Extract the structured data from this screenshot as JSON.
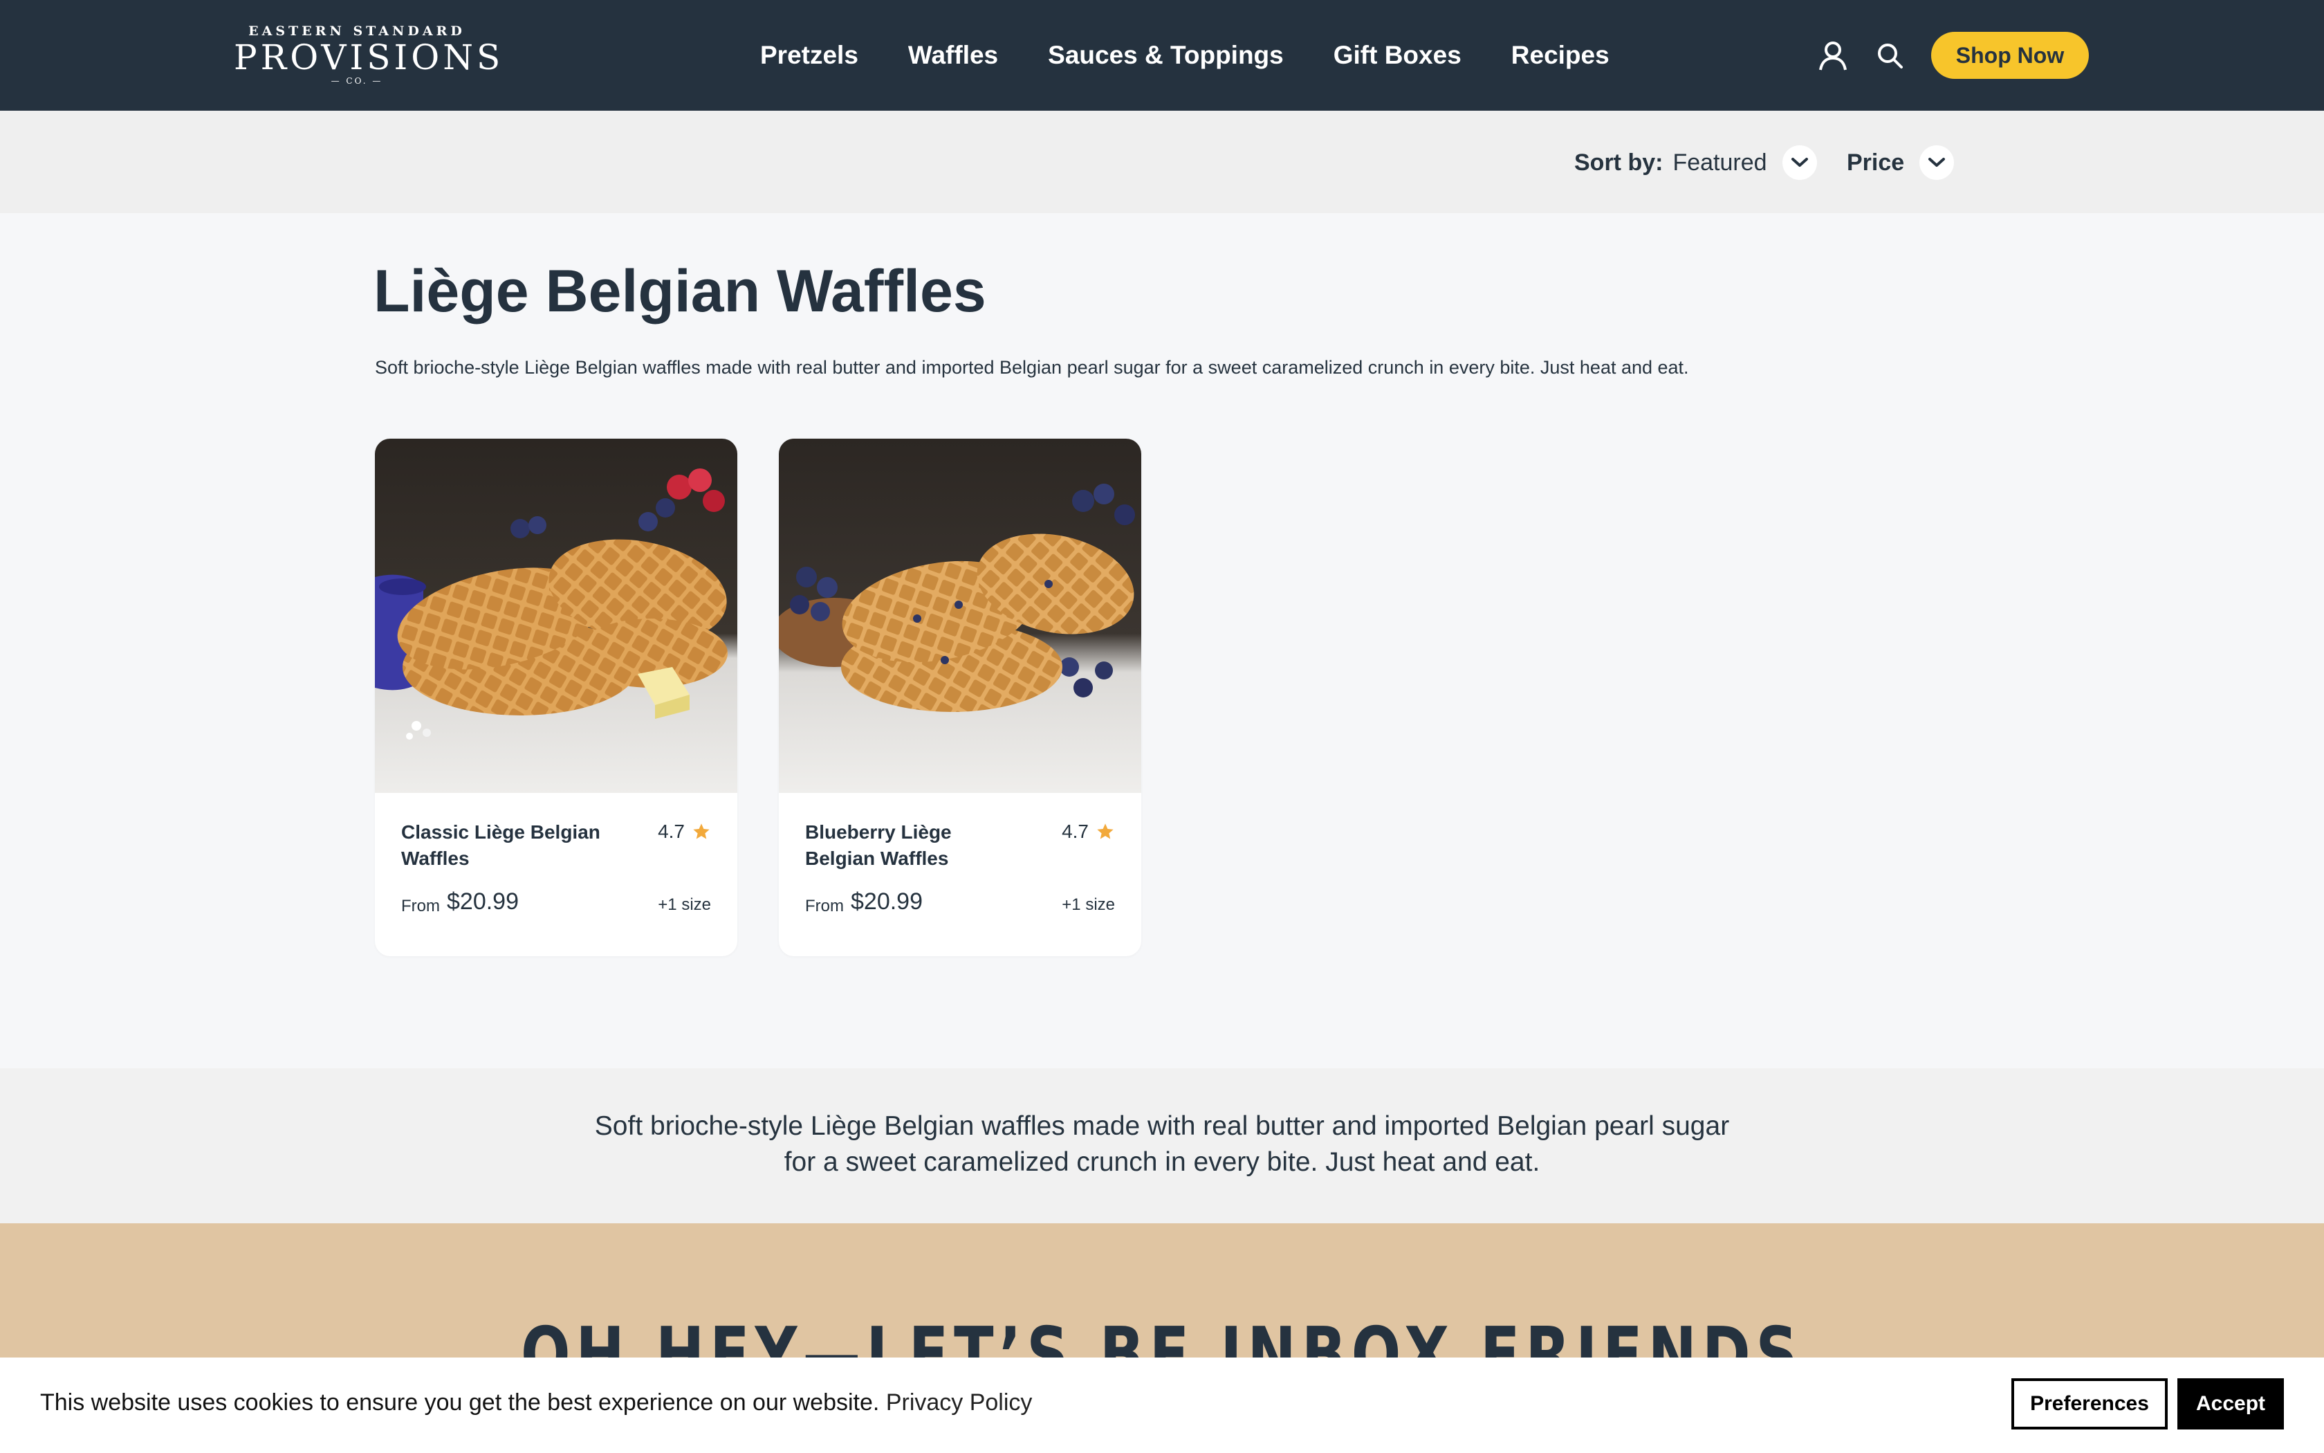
{
  "brand": {
    "logo_top": "EASTERN STANDARD",
    "logo_main": "PROVISIONS",
    "logo_bottom": "— CO. —",
    "primary_color": "#25323f",
    "accent_color": "#f7c52b"
  },
  "nav": {
    "items": [
      {
        "label": "Pretzels"
      },
      {
        "label": "Waffles"
      },
      {
        "label": "Sauces & Toppings"
      },
      {
        "label": "Gift Boxes"
      },
      {
        "label": "Recipes"
      }
    ],
    "account_icon": "user-icon",
    "search_icon": "search-icon",
    "cta_label": "Shop Now"
  },
  "sort": {
    "sort_label": "Sort by:",
    "sort_value": "Featured",
    "price_label": "Price"
  },
  "collection": {
    "title": "Liège Belgian Waffles",
    "description": "Soft brioche-style Liège Belgian waffles made with real butter and imported Belgian pearl sugar for a sweet caramelized crunch in every bite. Just heat and eat."
  },
  "products": [
    {
      "name": "Classic Liège Belgian Waffles",
      "rating": "4.7",
      "from_label": "From",
      "price": "$20.99",
      "sizes": "+1 size"
    },
    {
      "name": "Blueberry Liège Belgian Waffles",
      "rating": "4.7",
      "from_label": "From",
      "price": "$20.99",
      "sizes": "+1 size"
    }
  ],
  "footer_desc": {
    "line1": "Soft brioche-style Liège Belgian waffles made with real butter and imported Belgian pearl sugar",
    "line2": "for a sweet caramelized crunch in every bite. Just heat and eat."
  },
  "newsletter": {
    "title": "OH HEY—LET’S BE INBOX FRIENDS"
  },
  "cookie": {
    "text": "This website uses cookies to ensure you get the best experience on our website.",
    "link": "Privacy Policy",
    "preferences_label": "Preferences",
    "accept_label": "Accept"
  }
}
